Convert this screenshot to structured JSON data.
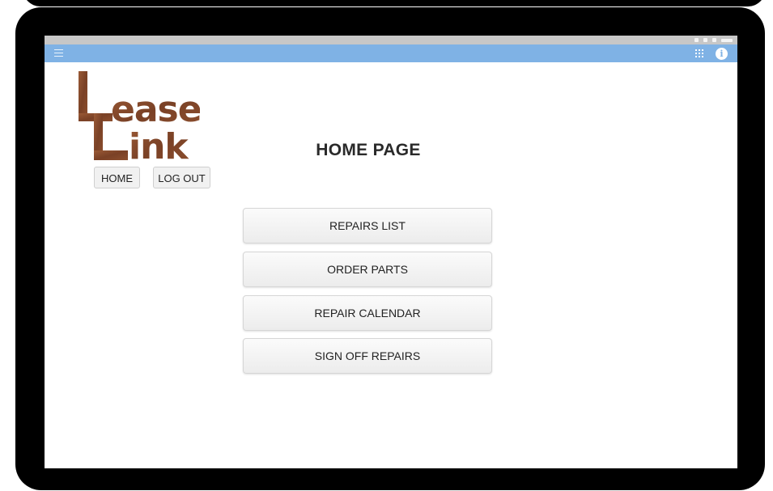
{
  "app": {
    "logo_text": "Lease Link"
  },
  "status_bar": {
    "icons": [
      "signal-icon",
      "wifi-icon",
      "battery-icon",
      "clock-icon"
    ]
  },
  "app_bar": {
    "background_color": "#7fb2e5",
    "icons": [
      "menu-icon",
      "apps-grid-icon",
      "info-icon"
    ],
    "info_glyph": "i"
  },
  "nav": {
    "home_label": "HOME",
    "logout_label": "LOG OUT"
  },
  "page": {
    "title": "HOME PAGE"
  },
  "menu": {
    "items": [
      {
        "label": "REPAIRS LIST"
      },
      {
        "label": "ORDER PARTS"
      },
      {
        "label": "REPAIR CALENDAR"
      },
      {
        "label": "SIGN OFF REPAIRS"
      }
    ]
  }
}
